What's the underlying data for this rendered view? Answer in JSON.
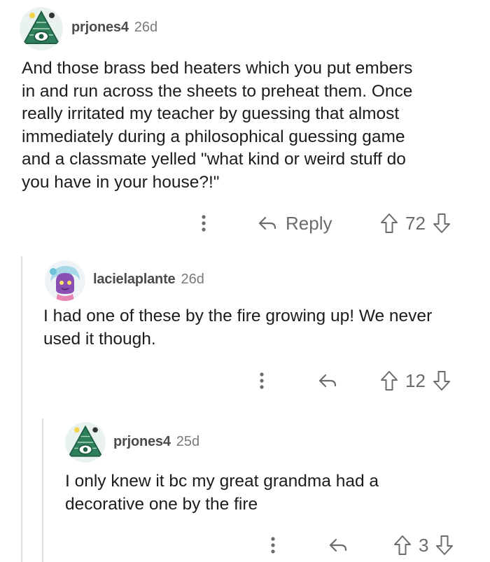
{
  "comments": [
    {
      "username": "prjones4",
      "age": "26d",
      "avatar": "pyramid-eye-avatar",
      "lines": [
        "And those brass bed heaters which you put embers",
        "in and run across the sheets to preheat them. Once",
        "really irritated my teacher by guessing that almost",
        "immediately during a philosophical guessing game",
        "and a classmate yelled \"what kind or weird stuff do",
        "you have in your house?!\""
      ],
      "reply_label": "Reply",
      "votes": "72"
    },
    {
      "username": "lacielaplante",
      "age": "26d",
      "avatar": "purple-character-avatar",
      "lines": [
        "I had one of these by the fire growing up! We never",
        "used it though."
      ],
      "votes": "12"
    },
    {
      "username": "prjones4",
      "age": "25d",
      "avatar": "pyramid-eye-avatar",
      "lines": [
        "I only knew it bc my great grandma had a",
        "decorative one by the fire"
      ],
      "votes": "3"
    }
  ],
  "colors": {
    "text": "#1c1c1c",
    "meta": "#7a7a7a",
    "thread_line": "#dcdcdc",
    "avatar_green": "#2e7d5b"
  },
  "icons": {
    "more": "vertical-dots-icon",
    "reply": "reply-arrow-icon",
    "upvote": "upvote-arrow-icon",
    "downvote": "downvote-arrow-icon"
  }
}
